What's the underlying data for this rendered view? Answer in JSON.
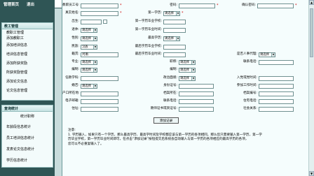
{
  "top_nav": {
    "home": "管理首页",
    "logout": "退出"
  },
  "sidebar": {
    "staff_menu": {
      "title": "教工管理",
      "items": [
        "教职工管理",
        "添加教职工",
        "添加培训信息",
        "培训信息管理",
        "添加所获奖励",
        "所获奖励管理",
        "添加论文信息",
        "论文信息管理"
      ]
    },
    "query_menu": {
      "title": "查询统计",
      "items": [
        "统计职称",
        "年龄段信息统计",
        "员工培训信息统计",
        "发表论文信息统计",
        "学历信息统计"
      ]
    }
  },
  "form": {
    "labels": {
      "staff_id": "教职员工号:",
      "password": "密码:",
      "confirm_password": "确认密码:",
      "real_name": "真实姓名:",
      "first_degree": "第一学历:",
      "birth_date": "出生:",
      "first_degree_school": "第一学历毕业学校:",
      "retire": "退休:",
      "first_degree_time": "第一学历毕业时间:",
      "gender": "性别:",
      "highest_degree": "最高学历:",
      "ethnicity": "民族:",
      "highest_degree_school": "最后学历毕业学校:",
      "native_place": "籍贯:",
      "highest_degree_time": "最后学历毕业时间:",
      "is_retired": "是否人事代理:",
      "major": "专业:",
      "title": "职称:",
      "phone": "联系电话:",
      "position": "编制:",
      "department": "编制:",
      "political": "政治面貌:",
      "party_time": "入党或党时间:",
      "marital": "婚否:",
      "id_card": "身份证号:",
      "work_time": "参加工作时间:",
      "household": "户口所在地:",
      "archive_loc": "档案所在:",
      "archive_no": "档案编号:",
      "email": "电子邮箱:",
      "phone2": "联系电话:",
      "home_phone": "住宅电话:",
      "address": "住址:",
      "teacher_cert": "教师证书或资证号:",
      "social_security": "社会关系:"
    },
    "values": {
      "select_default": "请选择",
      "native_place": "河南",
      "ethnicity": "汉族"
    },
    "add_button": "添加记录"
  },
  "note": {
    "title": "注意:",
    "lines": [
      "1. 学历输入，如果只有一个学历，那么最高学历、最高学时间及学校都应该与第一学历的各项相同，那么您只需要输入第一学历，第一学",
      "历毕业学校，第一学历毕业时间即可，在点击“添加记录”按钮提交后系统会自动输入与第一学历的各项相应的最高学历的各项，",
      "您可以不必重复输入了。"
    ]
  }
}
